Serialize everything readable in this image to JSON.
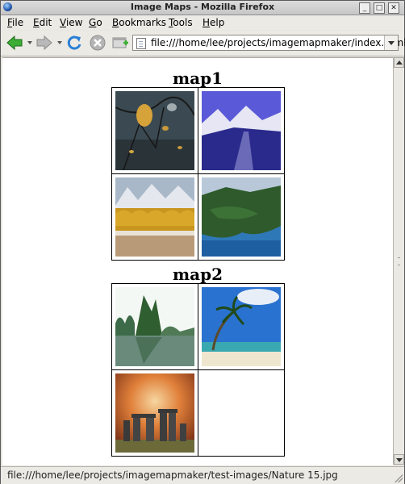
{
  "window": {
    "title": "Image Maps - Mozilla Firefox"
  },
  "menubar": {
    "items": [
      {
        "label": "File",
        "accel": "F",
        "rest": "ile"
      },
      {
        "label": "Edit",
        "accel": "E",
        "rest": "dit"
      },
      {
        "label": "View",
        "accel": "V",
        "rest": "iew"
      },
      {
        "label": "Go",
        "accel": "G",
        "rest": "o"
      },
      {
        "label": "Bookmarks",
        "accel": "B",
        "rest": "ookmarks"
      },
      {
        "label": "Tools",
        "accel": "T",
        "rest": "ools"
      },
      {
        "label": "Help",
        "accel": "H",
        "rest": "elp"
      }
    ]
  },
  "toolbar": {
    "back_icon": "back-arrow-icon",
    "forward_icon": "forward-arrow-icon",
    "reload_icon": "reload-icon",
    "stop_icon": "stop-icon",
    "newtab_icon": "new-tab-icon",
    "url": "file:///home/lee/projects/imagemapmaker/index.html"
  },
  "maps": [
    {
      "heading": "map1",
      "images": [
        "autumn-leaves-on-water",
        "snowy-mountain-valley",
        "golden-trees-before-mountains",
        "green-island-coast"
      ]
    },
    {
      "heading": "map2",
      "images": [
        "lake-with-trees",
        "palm-tree-beach",
        "stonehenge-sunset"
      ]
    }
  ],
  "status": {
    "text": "file:///home/lee/projects/imagemapmaker/test-images/Nature 15.jpg"
  },
  "colors": {
    "accent": "#2255aa",
    "back_arrow": "#3cae35",
    "stop_gray": "#9a9a9a"
  }
}
